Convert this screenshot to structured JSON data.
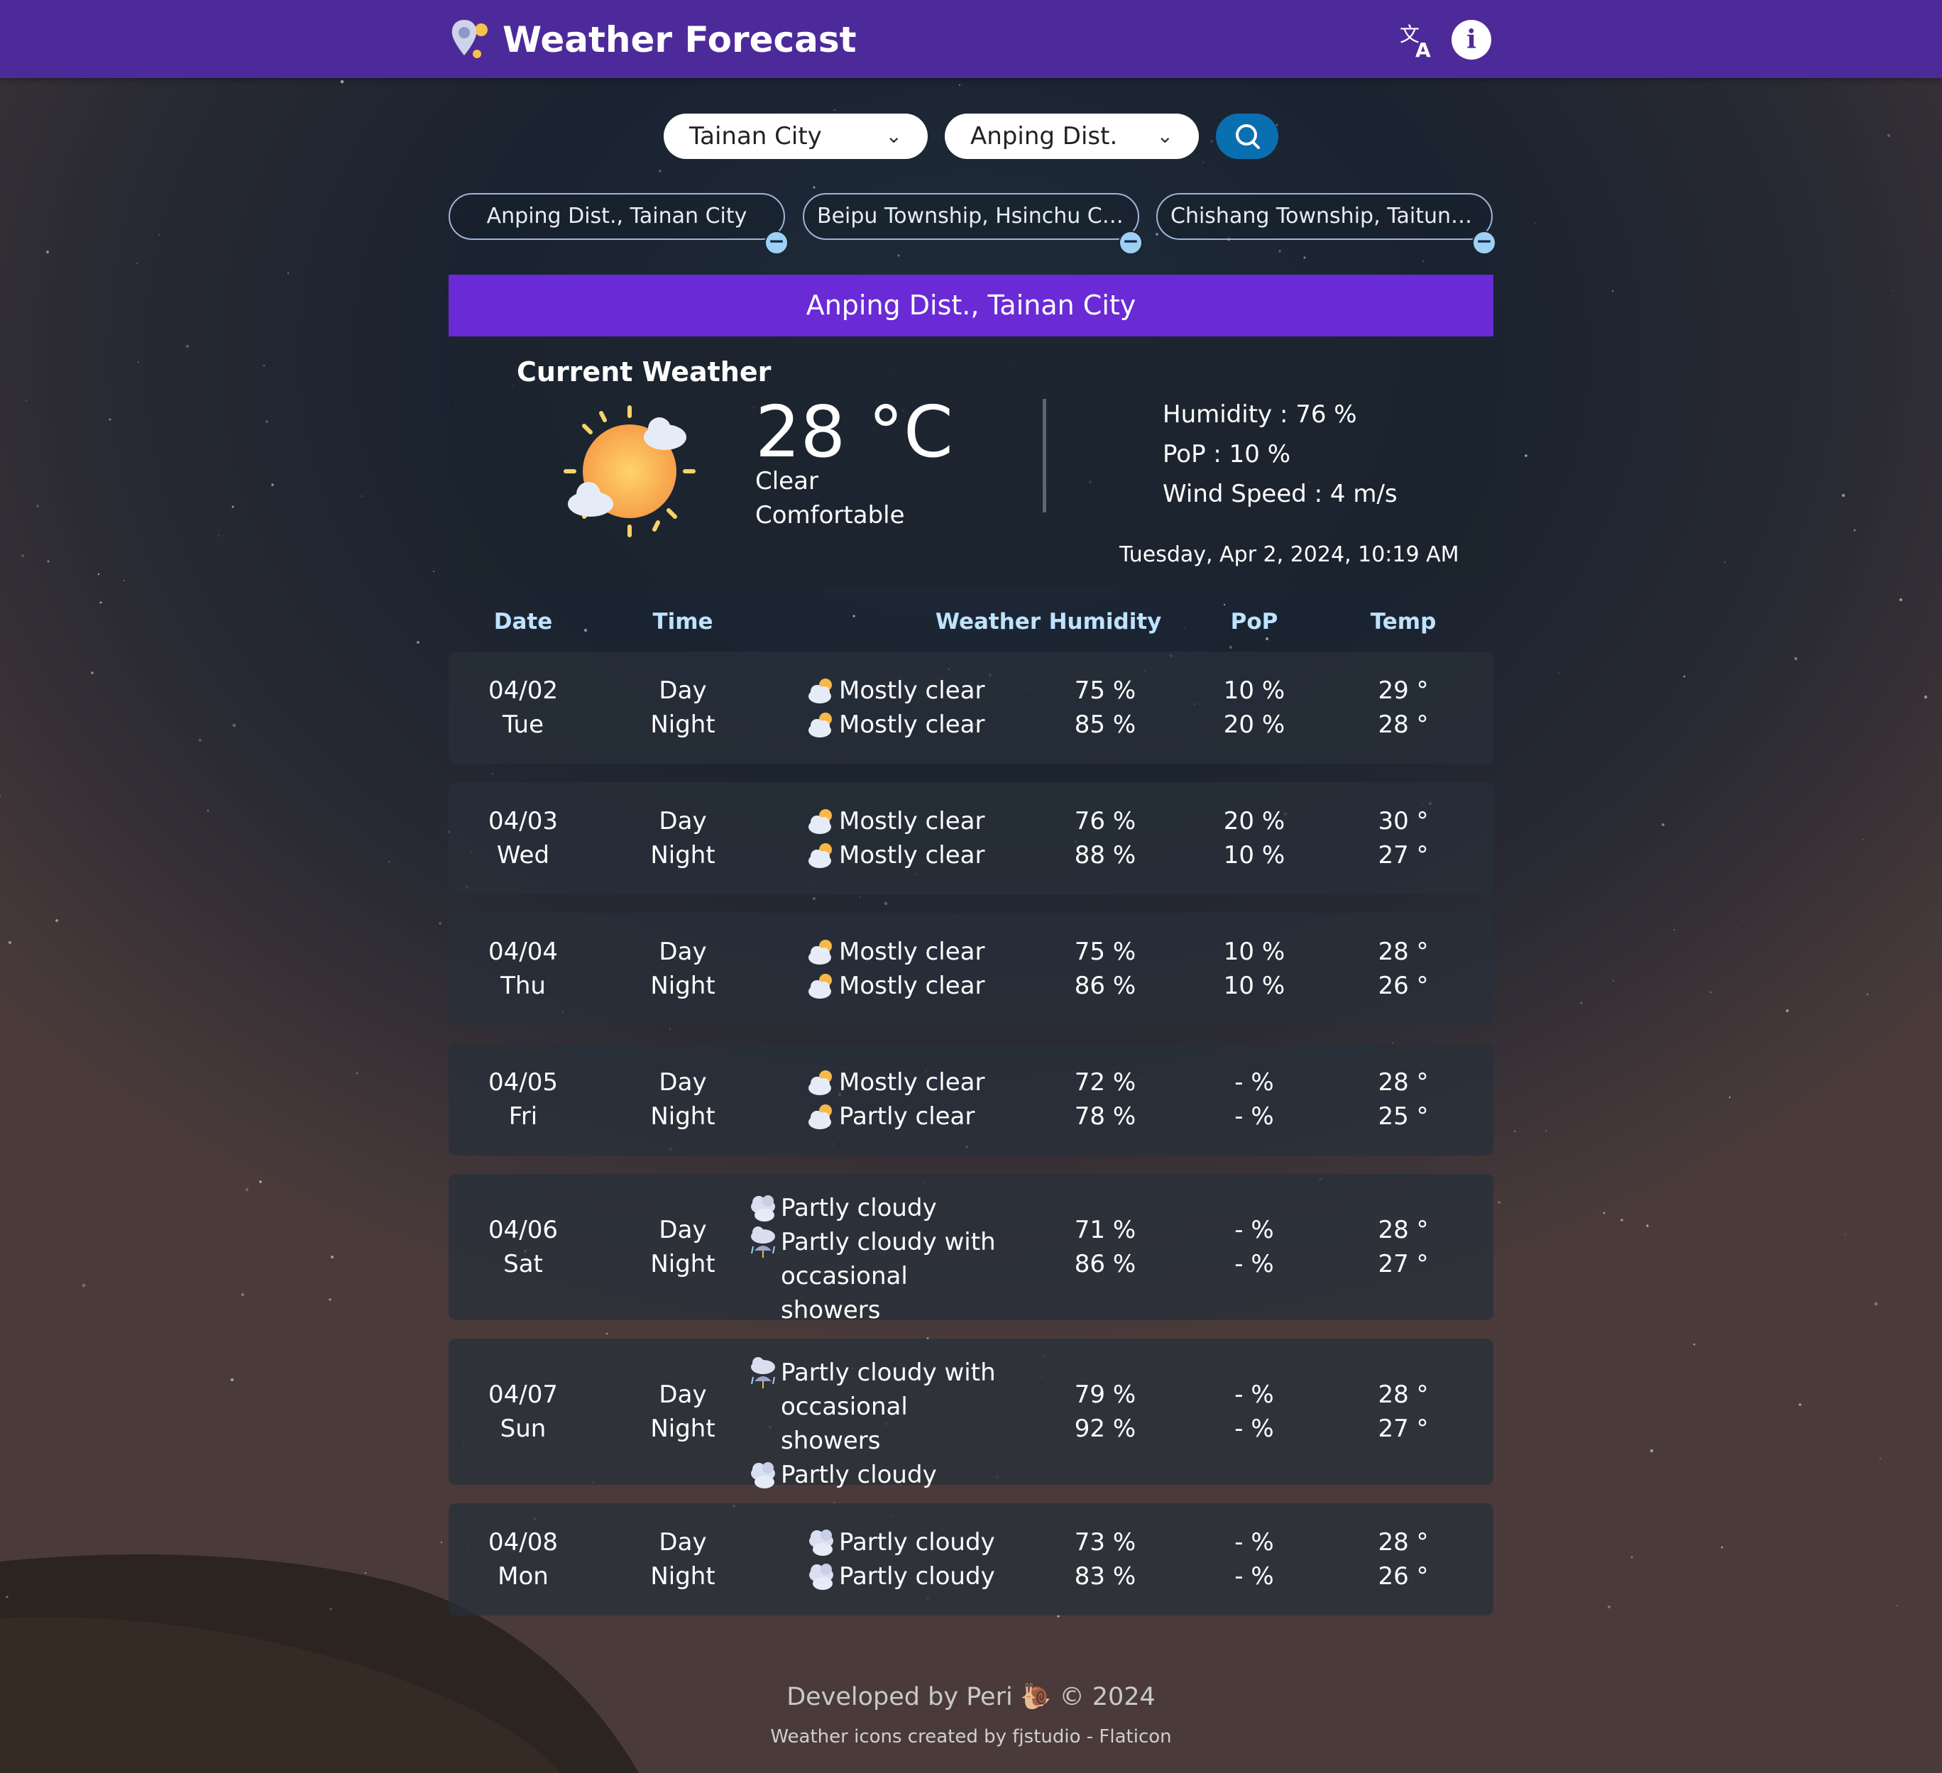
{
  "header": {
    "title": "Weather Forecast",
    "brand_color": "#4d2a99",
    "translate_icon": "translate-icon",
    "info_icon": "info-icon",
    "info_glyph": "i"
  },
  "search": {
    "city": "Tainan City",
    "district": "Anping Dist.",
    "button_icon": "search-icon"
  },
  "saved_locations": [
    "Anping Dist., Tainan City",
    "Beipu Township, Hsinchu County",
    "Chishang Township, Taitung County"
  ],
  "remove_glyph": "−",
  "location_title": "Anping Dist., Tainan City",
  "current": {
    "heading": "Current Weather",
    "temperature": "28 °C",
    "condition": "Clear",
    "comfort": "Comfortable",
    "humidity": "Humidity : 76 %",
    "pop": "PoP : 10 %",
    "wind": "Wind Speed : 4 m/s",
    "datetime": "Tuesday, Apr 2, 2024, 10:19 AM",
    "icon": "sun-cloud-icon"
  },
  "table": {
    "headers": [
      "Date",
      "Time",
      "Weather",
      "Humidity",
      "PoP",
      "Temp"
    ],
    "day_label": "Day",
    "night_label": "Night",
    "rows": [
      {
        "date": "04/02",
        "dow": "Tue",
        "day_wx": "Mostly clear",
        "night_wx": "Mostly clear",
        "day_icon": "sun-cloud",
        "night_icon": "sun-cloud",
        "day_hum": "75 %",
        "night_hum": "85 %",
        "day_pop": "10 %",
        "night_pop": "20 %",
        "day_temp": "29 °",
        "night_temp": "28 °"
      },
      {
        "date": "04/03",
        "dow": "Wed",
        "day_wx": "Mostly clear",
        "night_wx": "Mostly clear",
        "day_icon": "sun-cloud",
        "night_icon": "sun-cloud",
        "day_hum": "76 %",
        "night_hum": "88 %",
        "day_pop": "20 %",
        "night_pop": "10 %",
        "day_temp": "30 °",
        "night_temp": "27 °"
      },
      {
        "date": "04/04",
        "dow": "Thu",
        "day_wx": "Mostly clear",
        "night_wx": "Mostly clear",
        "day_icon": "sun-cloud",
        "night_icon": "sun-cloud",
        "day_hum": "75 %",
        "night_hum": "86 %",
        "day_pop": "10 %",
        "night_pop": "10 %",
        "day_temp": "28 °",
        "night_temp": "26 °"
      },
      {
        "date": "04/05",
        "dow": "Fri",
        "day_wx": "Mostly clear",
        "night_wx": "Partly clear",
        "day_icon": "sun-cloud",
        "night_icon": "sun-cloud",
        "day_hum": "72 %",
        "night_hum": "78 %",
        "day_pop": "- %",
        "night_pop": "- %",
        "day_temp": "28 °",
        "night_temp": "25 °"
      },
      {
        "date": "04/06",
        "dow": "Sat",
        "day_wx": "Partly cloudy",
        "night_wx": "Partly cloudy with occasional showers",
        "day_icon": "cloud",
        "night_icon": "rain-cloud",
        "day_hum": "71 %",
        "night_hum": "86 %",
        "day_pop": "- %",
        "night_pop": "- %",
        "day_temp": "28 °",
        "night_temp": "27 °"
      },
      {
        "date": "04/07",
        "dow": "Sun",
        "day_wx": "Partly cloudy with occasional showers",
        "night_wx": "Partly cloudy",
        "day_icon": "rain-cloud",
        "night_icon": "cloud",
        "day_hum": "79 %",
        "night_hum": "92 %",
        "day_pop": "- %",
        "night_pop": "- %",
        "day_temp": "28 °",
        "night_temp": "27 °"
      },
      {
        "date": "04/08",
        "dow": "Mon",
        "day_wx": "Partly cloudy",
        "night_wx": "Partly cloudy",
        "day_icon": "cloud",
        "night_icon": "cloud",
        "day_hum": "73 %",
        "night_hum": "83 %",
        "day_pop": "- %",
        "night_pop": "- %",
        "day_temp": "28 °",
        "night_temp": "26 °"
      }
    ]
  },
  "footer": {
    "developed": "Developed by Peri",
    "copyright": "© 2024",
    "credits": "Weather icons created by fjstudio - Flaticon"
  }
}
